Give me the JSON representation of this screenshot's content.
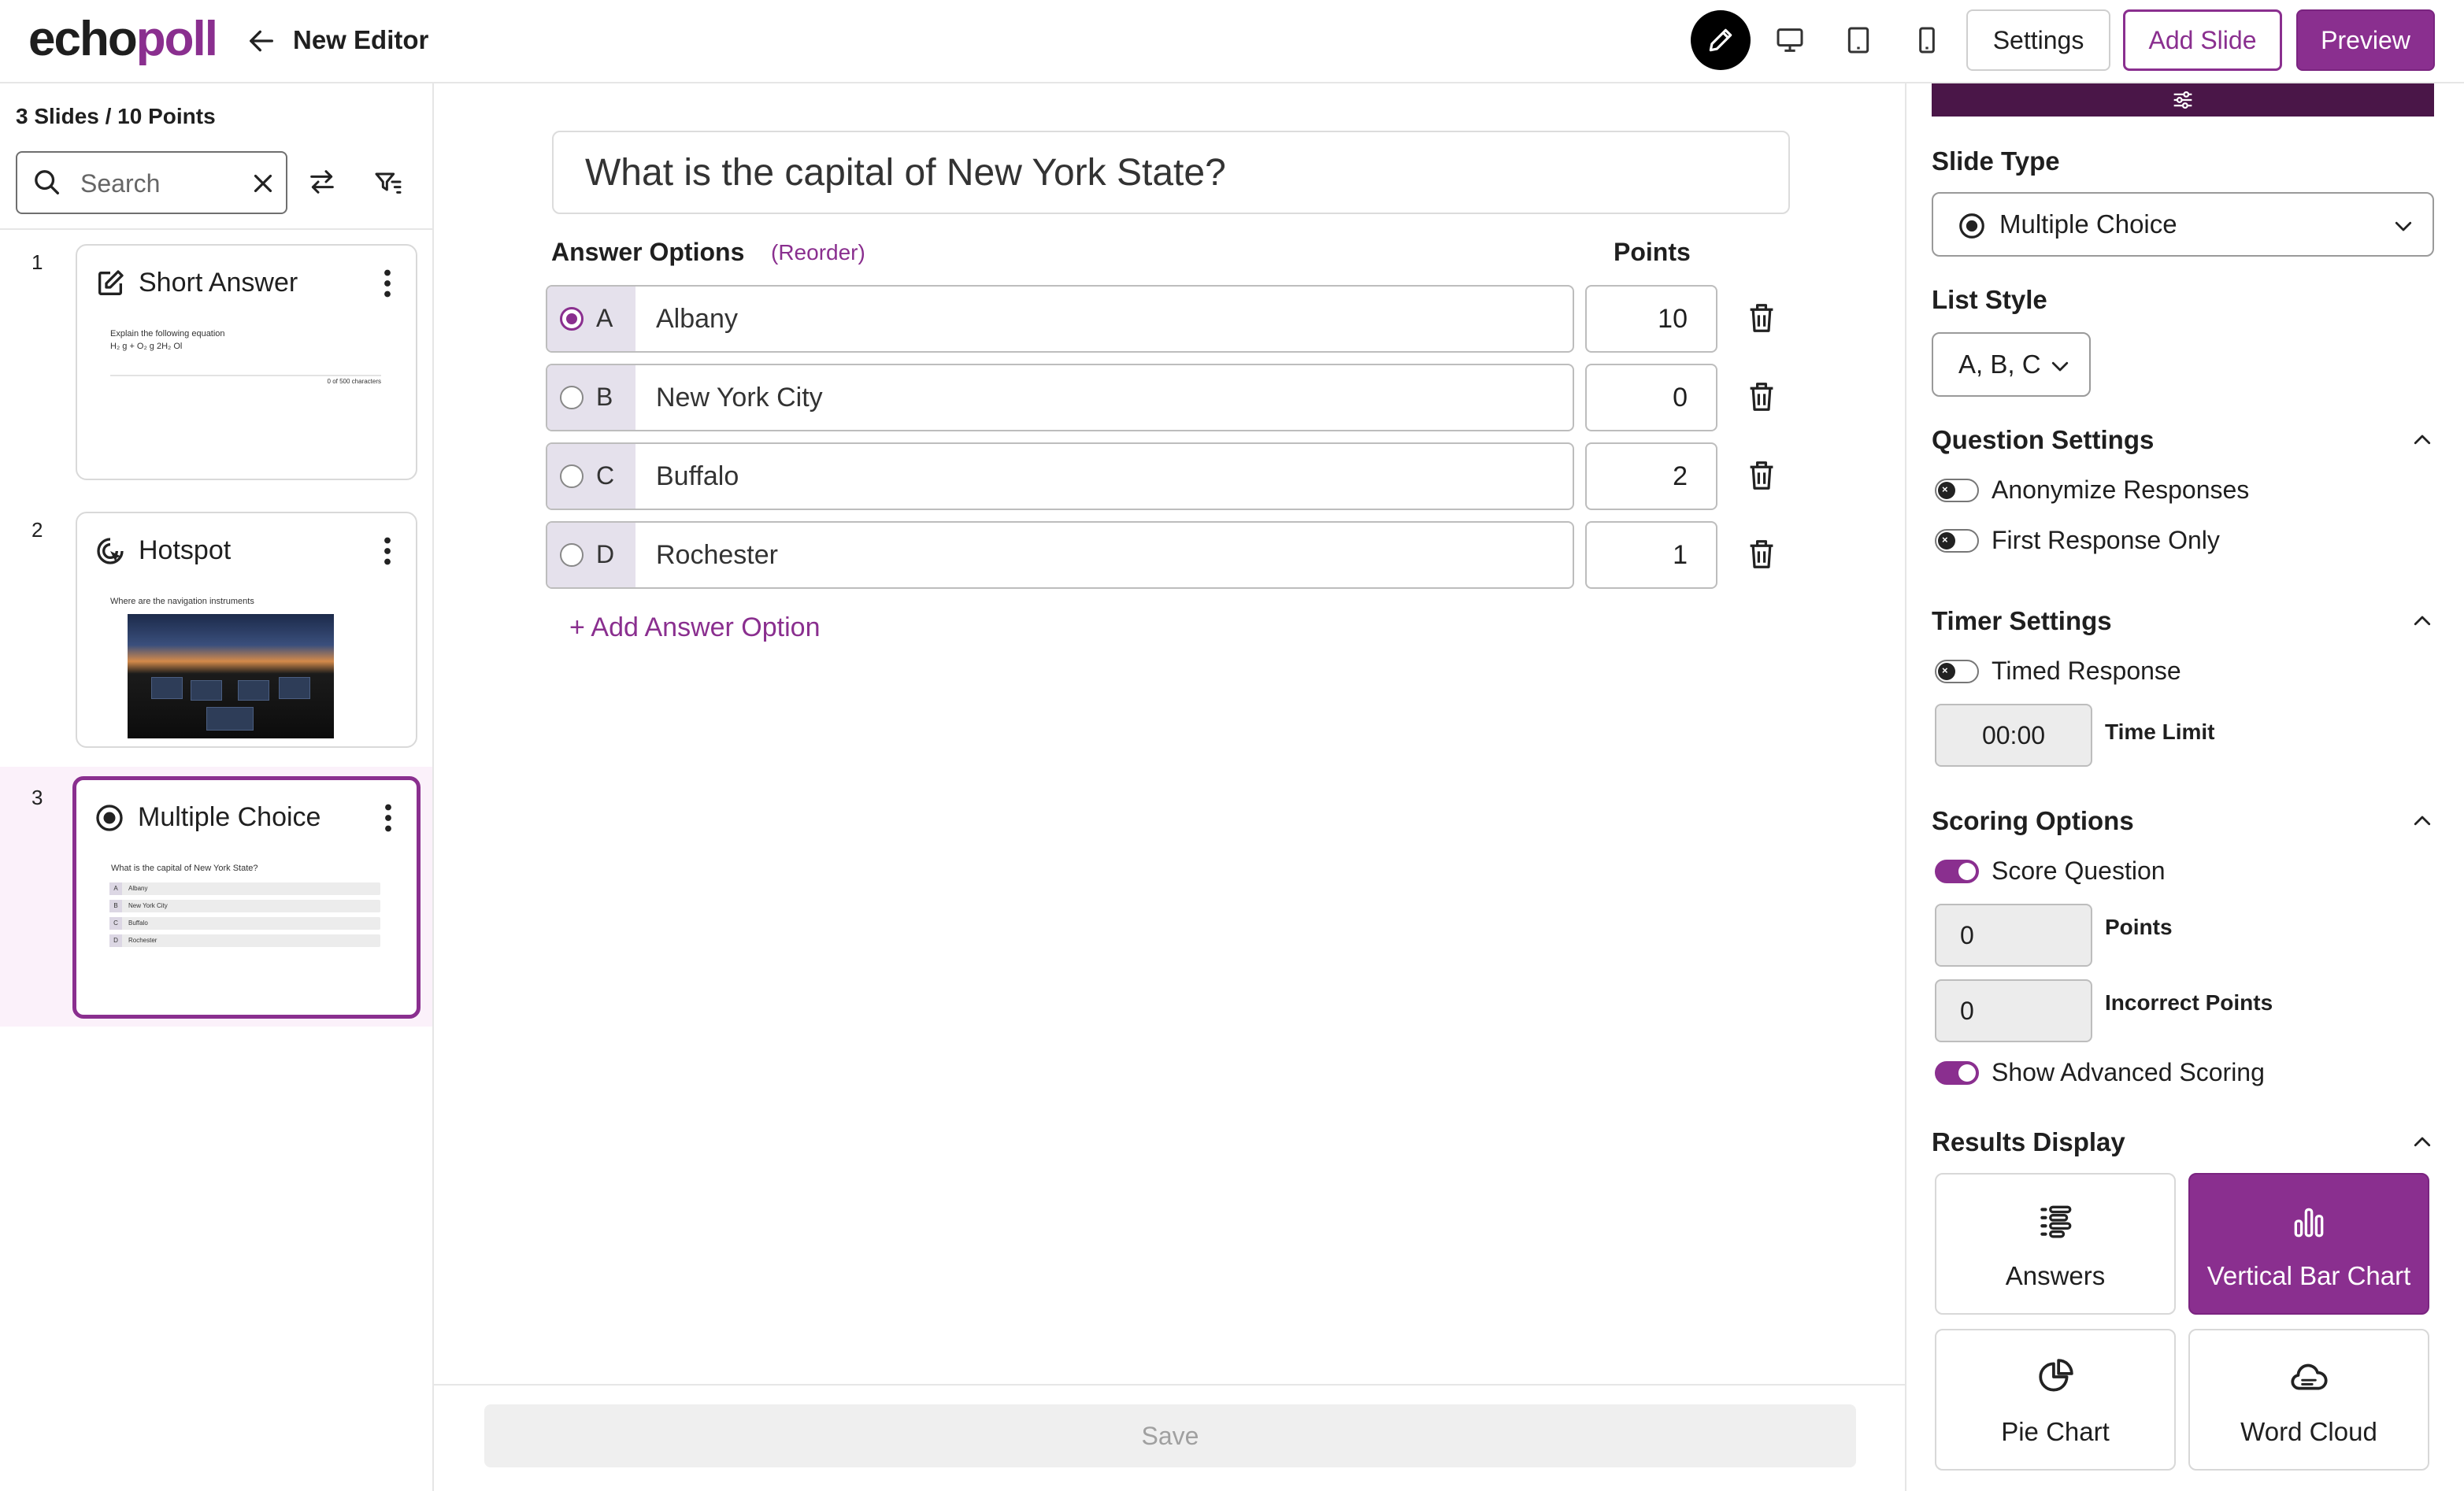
{
  "header": {
    "logo_part1": "echo",
    "logo_part2": "poll",
    "editor_title": "New Editor",
    "settings_label": "Settings",
    "add_slide_label": "Add Slide",
    "preview_label": "Preview"
  },
  "sidebar": {
    "slide_count": "3 Slides / 10 Points",
    "search_placeholder": "Search",
    "slides": [
      {
        "number": "1",
        "title": "Short Answer",
        "preview_line1": "Explain the following equation",
        "preview_line2": "H₂ g + O₂ g     2H₂ Ol",
        "preview_counter": "0 of 500 characters"
      },
      {
        "number": "2",
        "title": "Hotspot",
        "preview_line1": "Where are the navigation instruments"
      },
      {
        "number": "3",
        "title": "Multiple Choice",
        "preview_line1": "What is the capital of New York State?",
        "preview_options": [
          {
            "letter": "A",
            "text": "Albany"
          },
          {
            "letter": "B",
            "text": "New York City"
          },
          {
            "letter": "C",
            "text": "Buffalo"
          },
          {
            "letter": "D",
            "text": "Rochester"
          }
        ]
      }
    ]
  },
  "editor": {
    "question": "What is the capital of New York State?",
    "answer_options_label": "Answer Options",
    "reorder_label": "(Reorder)",
    "points_label": "Points",
    "options": [
      {
        "letter": "A",
        "text": "Albany",
        "points": "10",
        "selected": true
      },
      {
        "letter": "B",
        "text": "New York City",
        "points": "0",
        "selected": false
      },
      {
        "letter": "C",
        "text": "Buffalo",
        "points": "2",
        "selected": false
      },
      {
        "letter": "D",
        "text": "Rochester",
        "points": "1",
        "selected": false
      }
    ],
    "add_option_label": "+ Add Answer Option",
    "save_label": "Save"
  },
  "panel": {
    "slide_type_label": "Slide Type",
    "slide_type_value": "Multiple Choice",
    "list_style_label": "List Style",
    "list_style_value": "A, B, C",
    "question_settings_label": "Question Settings",
    "anonymize_label": "Anonymize Responses",
    "first_response_label": "First Response Only",
    "timer_settings_label": "Timer Settings",
    "timed_response_label": "Timed Response",
    "time_limit_value": "00:00",
    "time_limit_label": "Time Limit",
    "scoring_options_label": "Scoring Options",
    "score_question_label": "Score Question",
    "points_value": "0",
    "points_label": "Points",
    "incorrect_points_value": "0",
    "incorrect_points_label": "Incorrect Points",
    "advanced_scoring_label": "Show Advanced Scoring",
    "results_display_label": "Results Display",
    "results_options": [
      {
        "label": "Answers",
        "icon": "list-icon"
      },
      {
        "label": "Vertical Bar Chart",
        "icon": "bar-chart-icon"
      },
      {
        "label": "Pie Chart",
        "icon": "pie-chart-icon"
      },
      {
        "label": "Word Cloud",
        "icon": "cloud-icon"
      }
    ]
  },
  "colors": {
    "accent": "#8a2f8f",
    "accent_dark": "#4a1648"
  }
}
